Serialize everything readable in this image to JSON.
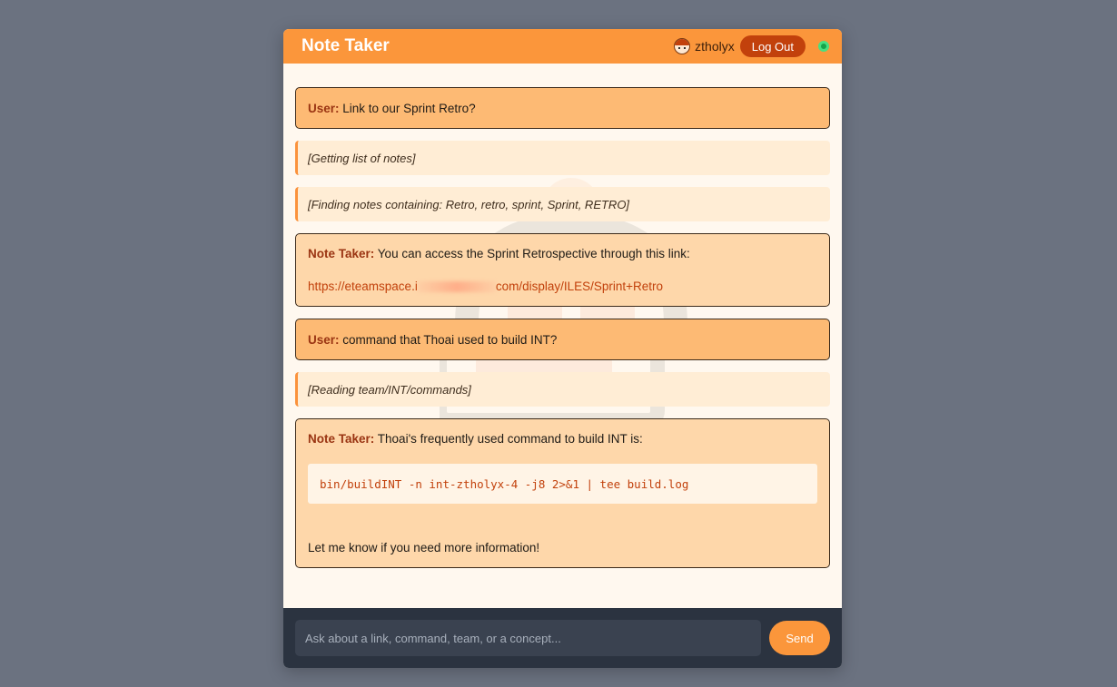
{
  "header": {
    "title": "Note Taker",
    "username": "ztholyx",
    "logout_label": "Log Out"
  },
  "messages": [
    {
      "type": "user",
      "speaker": "User:",
      "text": "Link to our Sprint Retro?"
    },
    {
      "type": "status",
      "text": "[Getting list of notes]"
    },
    {
      "type": "status",
      "text": "[Finding notes containing: Retro, retro, sprint, Sprint, RETRO]"
    },
    {
      "type": "bot",
      "speaker": "Note Taker:",
      "text": "You can access the Sprint Retrospective through this link:",
      "link_start": "https://eteamspace.i",
      "link_end": "com/display/ILES/Sprint+Retro"
    },
    {
      "type": "user",
      "speaker": "User:",
      "text": "command that Thoai used to build INT?"
    },
    {
      "type": "status",
      "text": "[Reading team/INT/commands]"
    },
    {
      "type": "bot",
      "speaker": "Note Taker:",
      "text": "Thoai's frequently used command to build INT is:",
      "code": "bin/buildINT -n int-ztholyx-4 -j8 2>&1 | tee build.log",
      "after": "Let me know if you need more information!"
    }
  ],
  "composer": {
    "placeholder": "Ask about a link, command, team, or a concept...",
    "send_label": "Send"
  },
  "colors": {
    "accent": "#fb963b",
    "user_bubble": "#fdba74",
    "bot_bubble": "#fed7aa",
    "status_bubble": "#ffedd5",
    "footer": "#2b3340",
    "online": "#22c55e"
  },
  "icons": {
    "avatar": "avatar-icon",
    "status": "online-status-icon"
  }
}
